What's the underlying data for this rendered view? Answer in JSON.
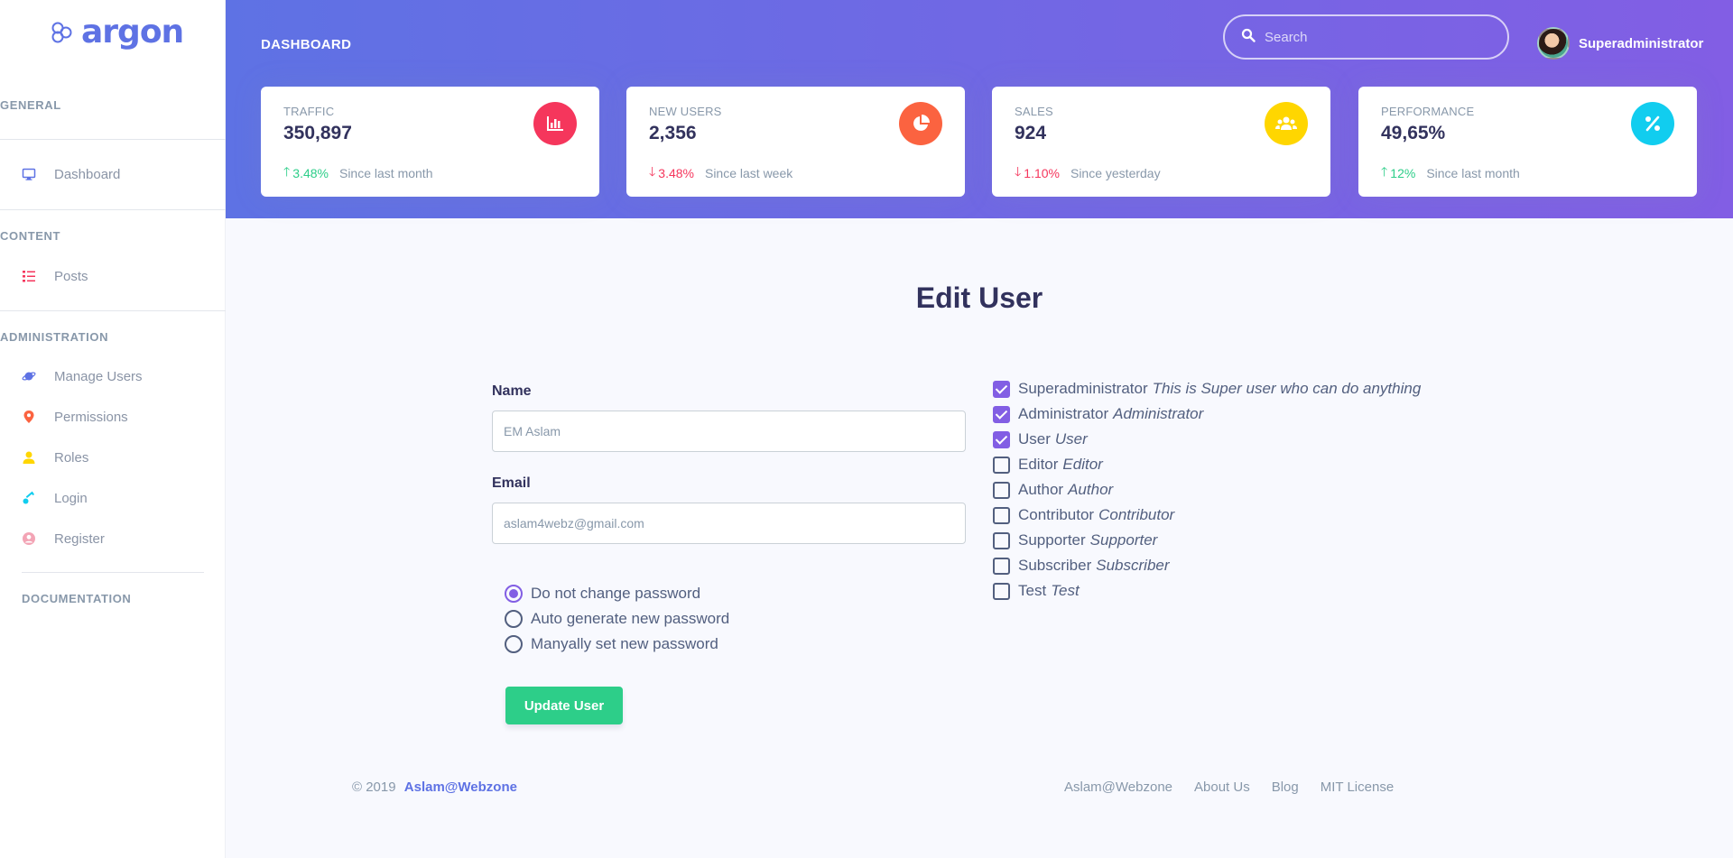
{
  "brand": {
    "name": "argon",
    "color": "#5e72e4"
  },
  "sidebar": {
    "sections": [
      {
        "heading": "GENERAL",
        "items": [
          {
            "label": "Dashboard",
            "icon": "monitor-icon",
            "color": "#5e72e4"
          }
        ]
      },
      {
        "heading": "CONTENT",
        "items": [
          {
            "label": "Posts",
            "icon": "list-icon",
            "color": "#f5365c"
          }
        ]
      },
      {
        "heading": "ADMINISTRATION",
        "items": [
          {
            "label": "Manage Users",
            "icon": "planet-icon",
            "color": "#5e72e4"
          },
          {
            "label": "Permissions",
            "icon": "pin-icon",
            "color": "#fb6340"
          },
          {
            "label": "Roles",
            "icon": "user-icon",
            "color": "#ffd600"
          },
          {
            "label": "Login",
            "icon": "key-icon",
            "color": "#11cdef"
          },
          {
            "label": "Register",
            "icon": "circle-user-icon",
            "color": "#f3a4b5"
          }
        ]
      },
      {
        "heading": "DOCUMENTATION",
        "items": []
      }
    ]
  },
  "header": {
    "title": "DASHBOARD",
    "search_placeholder": "Search",
    "user_name": "Superadministrator"
  },
  "stats": [
    {
      "label": "TRAFFIC",
      "value": "350,897",
      "change": "3.48%",
      "direction": "up",
      "since": "Since last month",
      "icon": "chart-bar-icon",
      "icon_color": "#f5365c"
    },
    {
      "label": "NEW USERS",
      "value": "2,356",
      "change": "3.48%",
      "direction": "down",
      "since": "Since last week",
      "icon": "chart-pie-icon",
      "icon_color": "#fb6340"
    },
    {
      "label": "SALES",
      "value": "924",
      "change": "1.10%",
      "direction": "down",
      "since": "Since yesterday",
      "icon": "users-icon",
      "icon_color": "#ffd600"
    },
    {
      "label": "PERFORMANCE",
      "value": "49,65%",
      "change": "12%",
      "direction": "up",
      "since": "Since last month",
      "icon": "percent-icon",
      "icon_color": "#11cdef"
    }
  ],
  "form": {
    "title": "Edit User",
    "name_label": "Name",
    "name_value": "EM Aslam",
    "email_label": "Email",
    "email_value": "aslam4webz@gmail.com",
    "password_options": [
      {
        "label": "Do not change password",
        "selected": true
      },
      {
        "label": "Auto generate new password",
        "selected": false
      },
      {
        "label": "Manyally set new password",
        "selected": false
      }
    ],
    "submit_label": "Update User",
    "roles": [
      {
        "name": "Superadministrator",
        "description": "This is Super user who can do anything",
        "checked": true
      },
      {
        "name": "Administrator",
        "description": "Administrator",
        "checked": true
      },
      {
        "name": "User",
        "description": "User",
        "checked": true
      },
      {
        "name": "Editor",
        "description": "Editor",
        "checked": false
      },
      {
        "name": "Author",
        "description": "Author",
        "checked": false
      },
      {
        "name": "Contributor",
        "description": "Contributor",
        "checked": false
      },
      {
        "name": "Supporter",
        "description": "Supporter",
        "checked": false
      },
      {
        "name": "Subscriber",
        "description": "Subscriber",
        "checked": false
      },
      {
        "name": "Test",
        "description": "Test",
        "checked": false
      }
    ]
  },
  "footer": {
    "copyright": "© 2019",
    "author_link": "Aslam@Webzone",
    "links": [
      "Aslam@Webzone",
      "About Us",
      "Blog",
      "MIT License"
    ]
  }
}
